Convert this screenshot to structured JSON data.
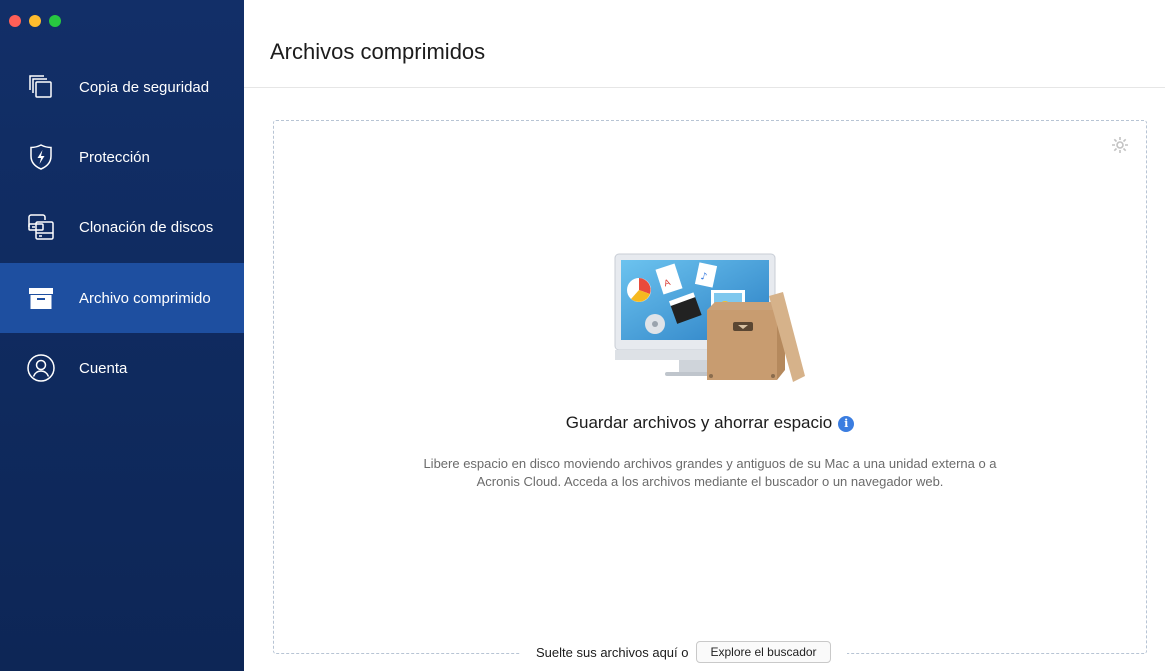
{
  "window": {
    "title": "Archivos comprimidos"
  },
  "sidebar": {
    "items": [
      {
        "label": "Copia de seguridad",
        "icon": "copies-icon",
        "active": false
      },
      {
        "label": "Protección",
        "icon": "shield-bolt-icon",
        "active": false
      },
      {
        "label": "Clonación de discos",
        "icon": "disk-clone-icon",
        "active": false
      },
      {
        "label": "Archivo comprimido",
        "icon": "archive-box-icon",
        "active": true
      },
      {
        "label": "Cuenta",
        "icon": "user-icon",
        "active": false
      }
    ]
  },
  "main": {
    "title": "Archivos comprimidos",
    "headline": "Guardar archivos y ahorrar espacio",
    "info_glyph": "i",
    "description": "Libere espacio en disco moviendo archivos grandes y antiguos de su Mac a una unidad externa o a Acronis Cloud. Acceda a los archivos mediante el buscador o un navegador web.",
    "drop_label": "Suelte sus archivos aquí o",
    "browse_button": "Explore el buscador",
    "illustration": "computer-and-archive-box-illustration"
  },
  "colors": {
    "sidebar_bg": "#122f68",
    "sidebar_active": "#1e4fa0",
    "accent": "#3b7de0",
    "dashed_border": "#b7c4d4"
  }
}
